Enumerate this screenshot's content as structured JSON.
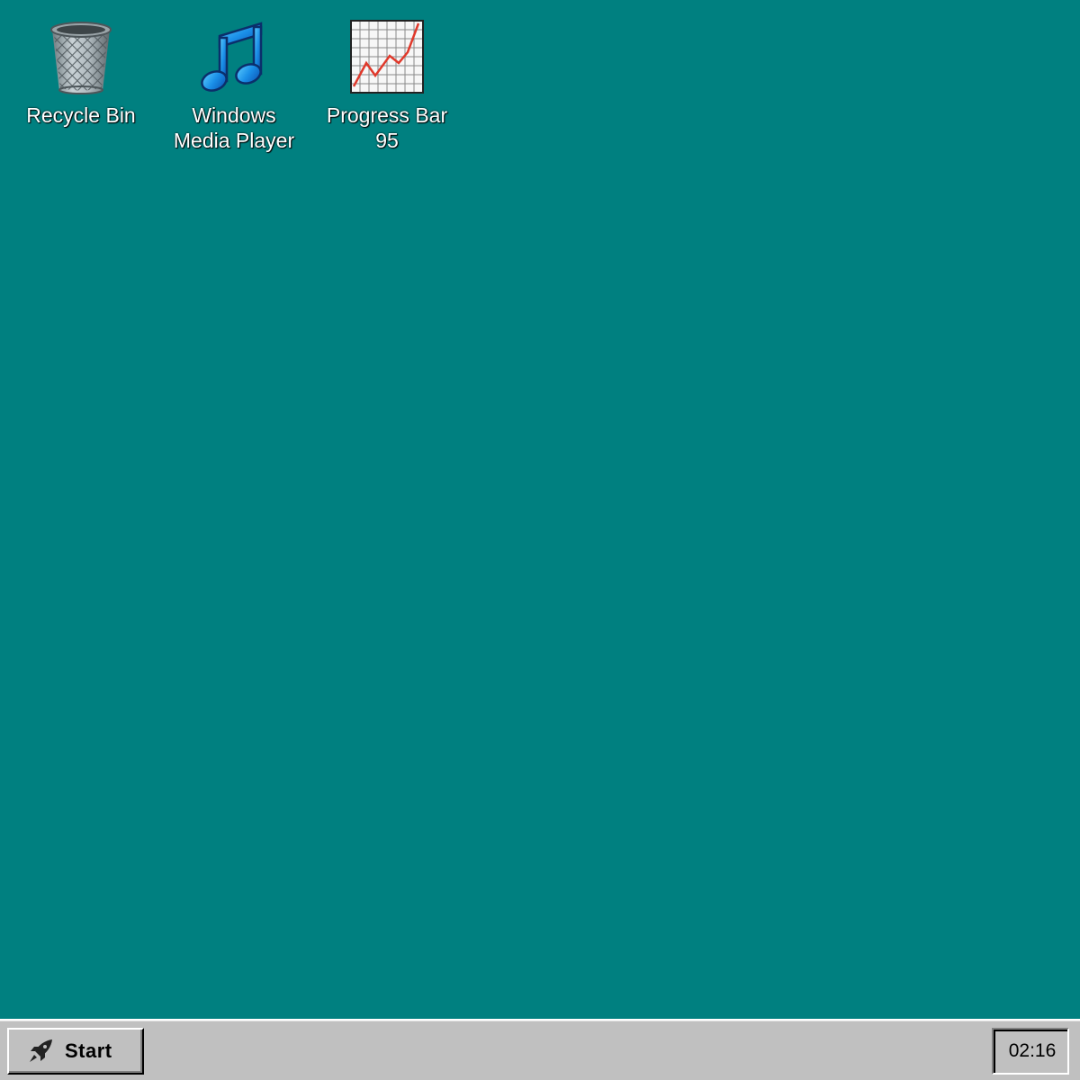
{
  "desktop": {
    "background_color": "#008080",
    "icons": [
      {
        "label": "Recycle Bin",
        "icon": "recycle-bin-icon"
      },
      {
        "label": "Windows\nMedia Player",
        "icon": "music-note-icon"
      },
      {
        "label": "Progress Bar\n95",
        "icon": "line-chart-icon"
      }
    ]
  },
  "taskbar": {
    "start_label": "Start",
    "start_icon": "rocket-icon",
    "clock": "02:16"
  }
}
